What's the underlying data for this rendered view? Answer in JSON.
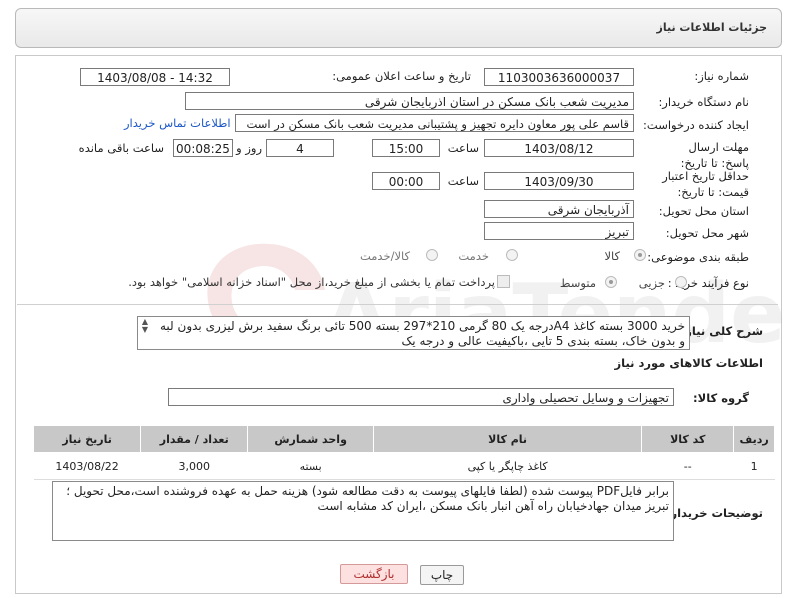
{
  "header": {
    "title": "جزئیات اطلاعات نیاز"
  },
  "form": {
    "need_number": {
      "label": "شماره نیاز:",
      "value": "1103003636000037"
    },
    "announce": {
      "label": "تاریخ و ساعت اعلان عمومی:",
      "value": "1403/08/08 - 14:32"
    },
    "buyer_org": {
      "label": "نام دستگاه خریدار:",
      "value": "مدیریت شعب بانک مسکن در استان اذربایجان شرقی"
    },
    "creator": {
      "label": "ایجاد کننده درخواست:",
      "value": "قاسم علی پور معاون دایره تجهیز و پشتیبانی مدیریت شعب بانک مسکن در است",
      "link": "اطلاعات تماس خریدار"
    },
    "deadline": {
      "label": "مهلت ارسال پاسخ: تا تاریخ:",
      "date": "1403/08/12",
      "time_label": "ساعت",
      "time": "15:00",
      "days": "4",
      "days_label": "روز و",
      "remaining": "00:08:25",
      "remaining_label": "ساعت باقی مانده"
    },
    "validity": {
      "label": "حداقل تاریخ اعتبار قیمت: تا تاریخ:",
      "date": "1403/09/30",
      "time_label": "ساعت",
      "time": "00:00"
    },
    "province": {
      "label": "استان محل تحویل:",
      "value": "آذربایجان شرقی"
    },
    "city": {
      "label": "شهر محل تحویل:",
      "value": "تبریز"
    },
    "category": {
      "label": "طبقه بندی موضوعی:",
      "options": [
        "کالا",
        "خدمت",
        "کالا/خدمت"
      ],
      "selected": "کالا"
    },
    "purchase_type": {
      "label": "نوع فرآیند خرید :",
      "options": [
        "جزیی",
        "متوسط"
      ],
      "selected": "متوسط",
      "note": "پرداخت تمام یا بخشی از مبلغ خرید،از محل \"اسناد خزانه اسلامی\" خواهد بود."
    },
    "description": {
      "label": "شرح کلی نیاز:",
      "text": "خرید 3000 بسته کاغذ A4درجه یک 80 گرمی 210*297 بسته 500 تائی برنگ سفید برش لیزری بدون لبه و بدون خاک، بسته بندی 5 تایی ،باکیفیت عالی و درجه یک"
    },
    "goods_info_title": "اطلاعات کالاهای مورد نیاز",
    "goods_group": {
      "label": "گروه کالا:",
      "value": "تجهیزات و وسایل تحصیلی واداری"
    }
  },
  "table": {
    "headers": [
      "ردیف",
      "کد کالا",
      "نام کالا",
      "واحد شمارش",
      "تعداد / مقدار",
      "تاریخ نیاز"
    ],
    "rows": [
      [
        "1",
        "--",
        "کاغذ چاپگر یا کپی",
        "بسته",
        "3,000",
        "1403/08/22"
      ]
    ]
  },
  "buyer_notes": {
    "label": "توضیحات خریدار:",
    "text": "برابر فایلPDF پیوست شده (لطفا فایلهای پیوست به دقت مطالعه شود) هزینه حمل به عهده فروشنده است،محل تحویل ؛ تبریز میدان جهادخیابان راه آهن انبار بانک مسکن ،ایران کد مشابه است"
  },
  "buttons": {
    "print": "چاپ",
    "back": "بازگشت"
  },
  "watermark": "AriaTender.neT"
}
